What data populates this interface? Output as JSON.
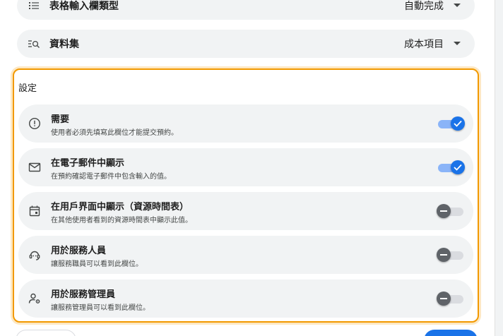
{
  "fields": {
    "input_type": {
      "label": "表格輸入欄類型",
      "value": "自動完成",
      "icon": "list-icon"
    },
    "dataset": {
      "label": "資料集",
      "value": "成本項目",
      "icon": "search-list-icon"
    }
  },
  "settings": {
    "title": "設定",
    "items": [
      {
        "title": "需要",
        "description": "使用者必須先填寫此欄位才能提交預約。",
        "enabled": true,
        "icon": "alert-circle-icon"
      },
      {
        "title": "在電子郵件中顯示",
        "description": "在預約確認電子郵件中包含輸入的值。",
        "enabled": true,
        "icon": "mail-icon"
      },
      {
        "title": "在用戶界面中顯示（資源時間表）",
        "description": "在其他使用者看到的資源時間表中顯示此值。",
        "enabled": false,
        "icon": "calendar-icon"
      },
      {
        "title": "用於服務人員",
        "description": "讓服務職員可以看到此欄位。",
        "enabled": false,
        "icon": "support-agent-icon"
      },
      {
        "title": "用於服務管理員",
        "description": "讓服務管理員可以看到此欄位。",
        "enabled": false,
        "icon": "manage-accounts-icon"
      }
    ]
  },
  "colors": {
    "accent": "#1a73e8",
    "highlight": "#f29900"
  }
}
